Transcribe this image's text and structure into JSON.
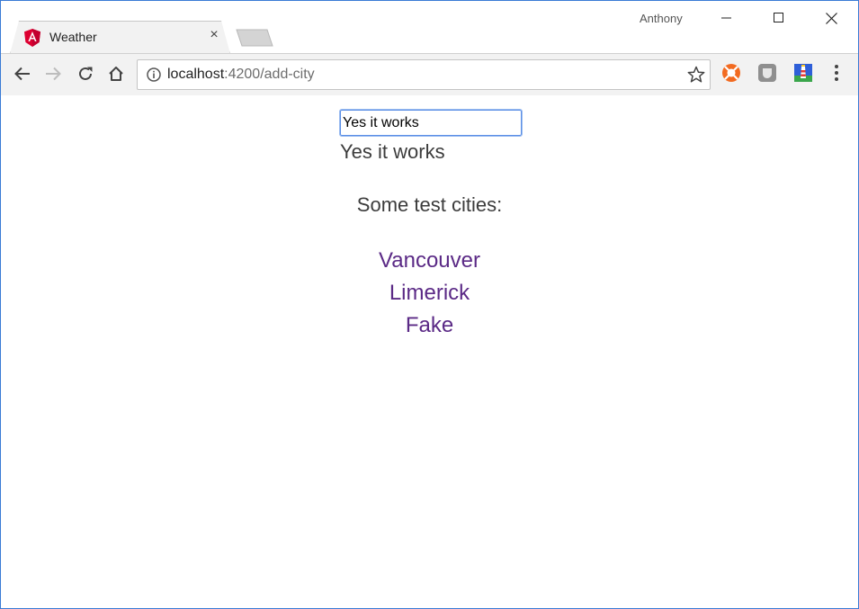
{
  "browser": {
    "tab": {
      "title": "Weather",
      "close_glyph": "×",
      "favicon": "angular-icon"
    },
    "profile_name": "Anthony",
    "window_controls": [
      "minimize-icon",
      "maximize-icon",
      "close-icon"
    ],
    "toolbar": {
      "buttons": [
        "back-arrow-icon",
        "forward-arrow-icon",
        "reload-icon",
        "home-icon"
      ],
      "url_host": "localhost",
      "url_path": ":4200/add-city",
      "extensions": [
        "lifebuoy-extension-icon",
        "gray-extension-icon",
        "lighthouse-extension-icon",
        "menu-dots-icon"
      ]
    },
    "colors": {
      "accent": "#3a7bd5",
      "link_visited": "#5b2a86",
      "angular_red": "#dd0031"
    }
  },
  "page": {
    "input": {
      "value": "Yes it works",
      "placeholder": ""
    },
    "echo_text": "Yes it works",
    "heading": "Some test cities:",
    "cities": [
      "Vancouver",
      "Limerick",
      "Fake"
    ]
  }
}
